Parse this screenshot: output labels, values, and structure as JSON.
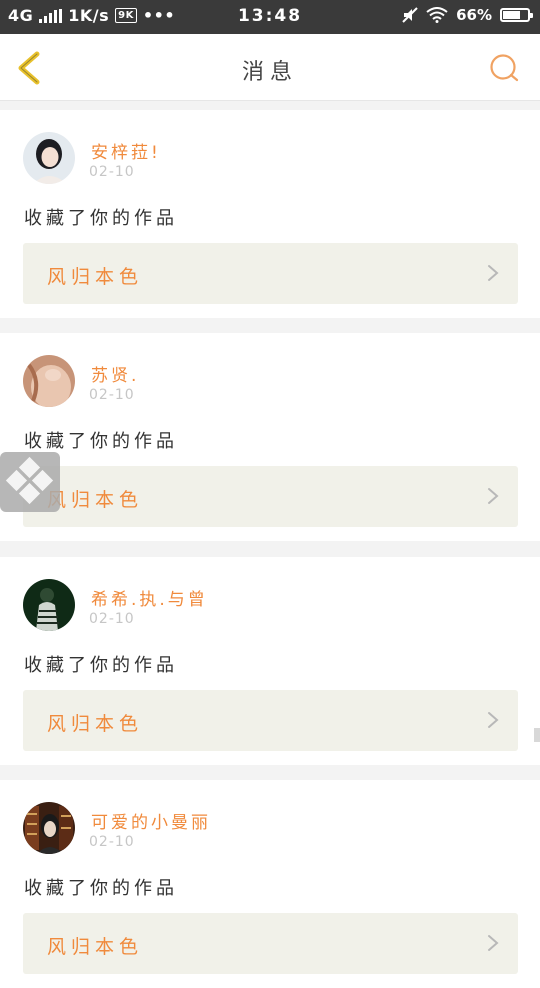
{
  "status_bar": {
    "network": "4G",
    "speed": "1K/s",
    "speed_badge": "9K",
    "more": "•••",
    "time": "13:48",
    "battery_percent": "66%",
    "battery_level": 0.66
  },
  "header": {
    "title": "消息"
  },
  "colors": {
    "accent": "#f08a3c",
    "back_icon": "#e8c12c",
    "card_box": "#f1f1e9"
  },
  "notifications": [
    {
      "username": "安梓菈!",
      "date": "02-10",
      "action": "收藏了你的作品",
      "work_title": "风归本色",
      "avatar_icon": "woman-portrait-avatar"
    },
    {
      "username": "苏贤.",
      "date": "02-10",
      "action": "收藏了你的作品",
      "work_title": "风归本色",
      "avatar_icon": "peach-portrait-avatar"
    },
    {
      "username": "希希.执.与曾",
      "date": "02-10",
      "action": "收藏了你的作品",
      "work_title": "风归本色",
      "avatar_icon": "dark-green-figure-avatar"
    },
    {
      "username": "可爱的小曼丽",
      "date": "02-10",
      "action": "收藏了你的作品",
      "work_title": "风归本色",
      "avatar_icon": "library-figure-avatar"
    }
  ]
}
